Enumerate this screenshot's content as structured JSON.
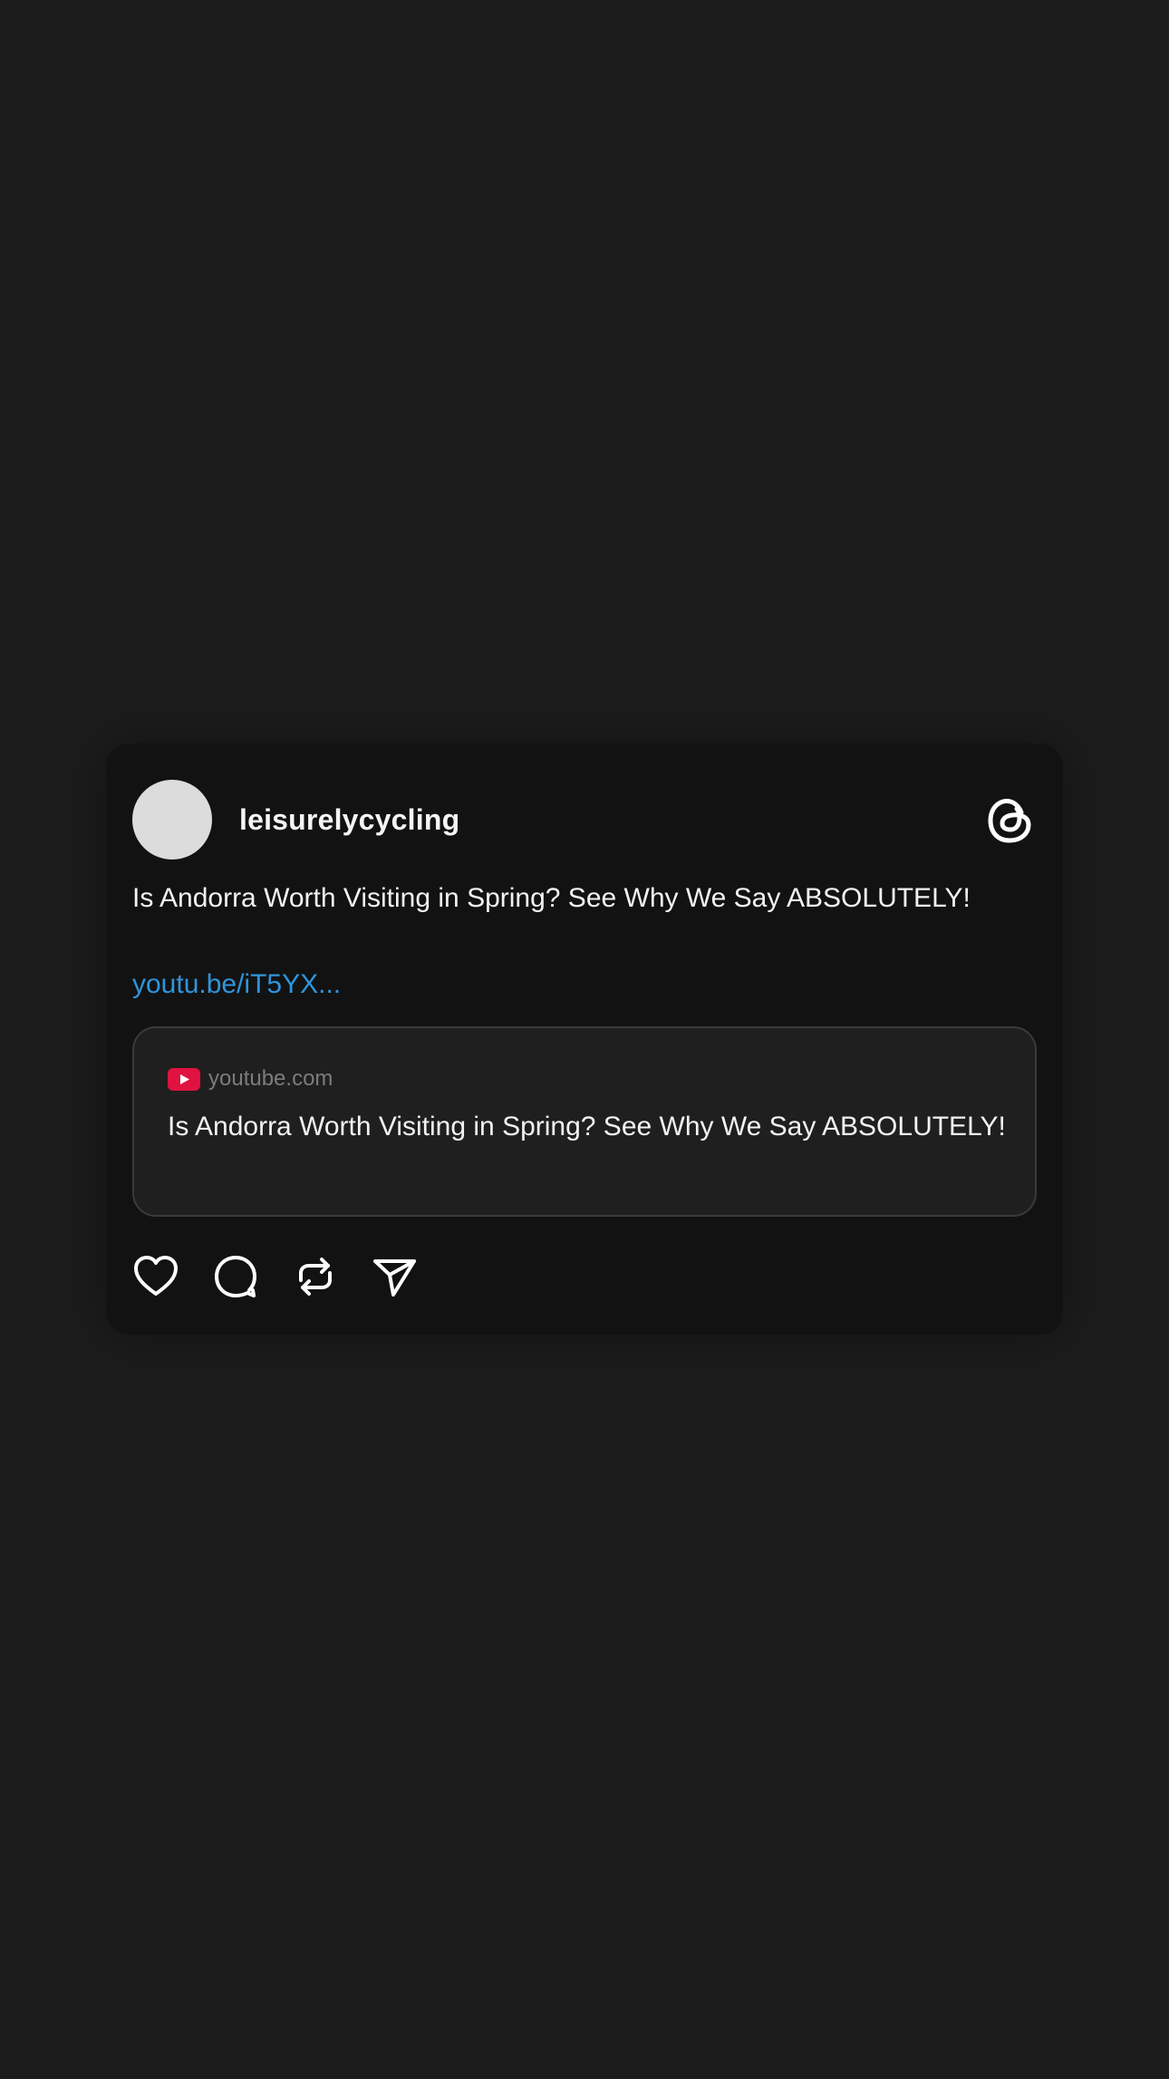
{
  "post": {
    "username": "leisurelycycling",
    "text": "Is Andorra Worth Visiting in Spring? See Why We Say ABSOLUTELY!",
    "link_text": "youtu.be/iT5YX...",
    "link_preview": {
      "domain": "youtube.com",
      "title": "Is Andorra Worth Visiting in Spring? See Why We Say ABSOLUTELY!",
      "icon": "youtube-logo-icon"
    },
    "actions": [
      {
        "icon": "heart-icon"
      },
      {
        "icon": "comment-icon"
      },
      {
        "icon": "repost-icon"
      },
      {
        "icon": "share-icon"
      }
    ],
    "brand_icon": "threads-logo-icon"
  },
  "colors": {
    "page_background": "#1c1c1c",
    "card_background": "#121212",
    "link": "#2f95dc",
    "youtube_red": "#e0123f"
  }
}
